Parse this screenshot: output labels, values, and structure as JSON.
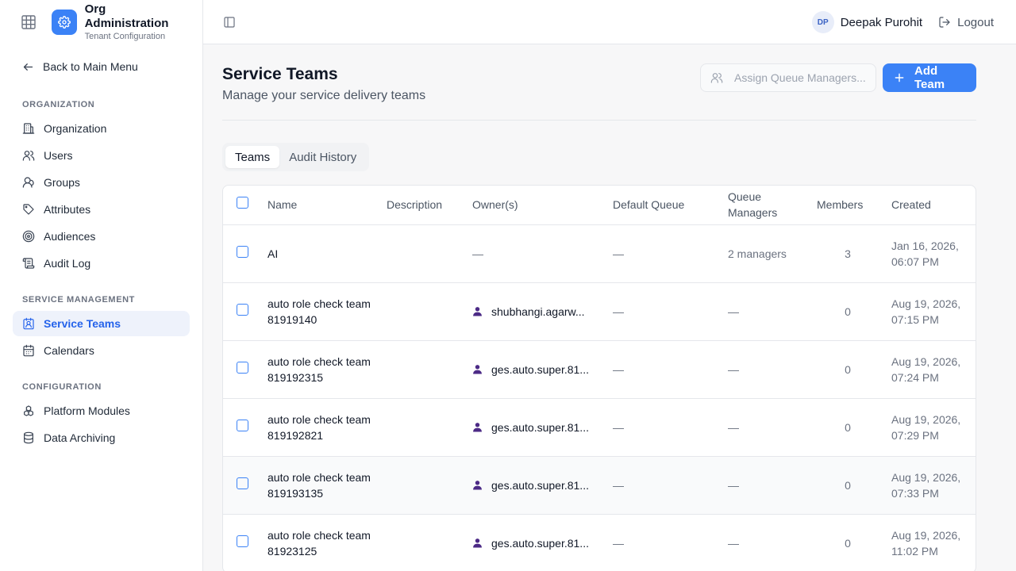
{
  "brand": {
    "title": "Org Administration",
    "subtitle": "Tenant Configuration"
  },
  "sidebar": {
    "back_label": "Back to Main Menu",
    "sections": [
      {
        "label": "ORGANIZATION",
        "items": [
          {
            "label": "Organization",
            "icon": "building-icon"
          },
          {
            "label": "Users",
            "icon": "users-icon"
          },
          {
            "label": "Groups",
            "icon": "groups-icon"
          },
          {
            "label": "Attributes",
            "icon": "tag-icon"
          },
          {
            "label": "Audiences",
            "icon": "target-icon"
          },
          {
            "label": "Audit Log",
            "icon": "scroll-icon"
          }
        ]
      },
      {
        "label": "SERVICE MANAGEMENT",
        "items": [
          {
            "label": "Service Teams",
            "icon": "contact-icon",
            "active": true
          },
          {
            "label": "Calendars",
            "icon": "calendar-icon"
          }
        ]
      },
      {
        "label": "CONFIGURATION",
        "items": [
          {
            "label": "Platform Modules",
            "icon": "boxes-icon"
          },
          {
            "label": "Data Archiving",
            "icon": "database-icon"
          }
        ]
      }
    ]
  },
  "header": {
    "user_initials": "DP",
    "user_name": "Deepak Purohit",
    "logout_label": "Logout"
  },
  "page": {
    "title": "Service Teams",
    "subtitle": "Manage your service delivery teams",
    "assign_label": "Assign Queue Managers...",
    "add_label": "Add Team",
    "tabs": [
      "Teams",
      "Audit History"
    ]
  },
  "table": {
    "columns": [
      "Name",
      "Description",
      "Owner(s)",
      "Default Queue",
      "Queue Managers",
      "Members",
      "Created"
    ],
    "rows": [
      {
        "name": "AI",
        "description": "",
        "owner": "—",
        "default_queue": "—",
        "queue_managers": "2 managers",
        "members": "3",
        "created": "Jan 16, 2026, 06:07 PM"
      },
      {
        "name": "auto role check team 81919140",
        "description": "",
        "owner": "shubhangi.agarw...",
        "default_queue": "—",
        "queue_managers": "—",
        "members": "0",
        "created": "Aug 19, 2026, 07:15 PM"
      },
      {
        "name": "auto role check team 819192315",
        "description": "",
        "owner": "ges.auto.super.81...",
        "default_queue": "—",
        "queue_managers": "—",
        "members": "0",
        "created": "Aug 19, 2026, 07:24 PM"
      },
      {
        "name": "auto role check team 819192821",
        "description": "",
        "owner": "ges.auto.super.81...",
        "default_queue": "—",
        "queue_managers": "—",
        "members": "0",
        "created": "Aug 19, 2026, 07:29 PM"
      },
      {
        "name": "auto role check team 819193135",
        "description": "",
        "owner": "ges.auto.super.81...",
        "default_queue": "—",
        "queue_managers": "—",
        "members": "0",
        "created": "Aug 19, 2026, 07:33 PM"
      },
      {
        "name": "auto role check team 81923125",
        "description": "",
        "owner": "ges.auto.super.81...",
        "default_queue": "—",
        "queue_managers": "—",
        "members": "0",
        "created": "Aug 19, 2026, 11:02 PM"
      }
    ]
  },
  "colors": {
    "accent": "#3b82f6",
    "active_bg": "#eef2fb",
    "owner_icon": "#4c2a86"
  }
}
